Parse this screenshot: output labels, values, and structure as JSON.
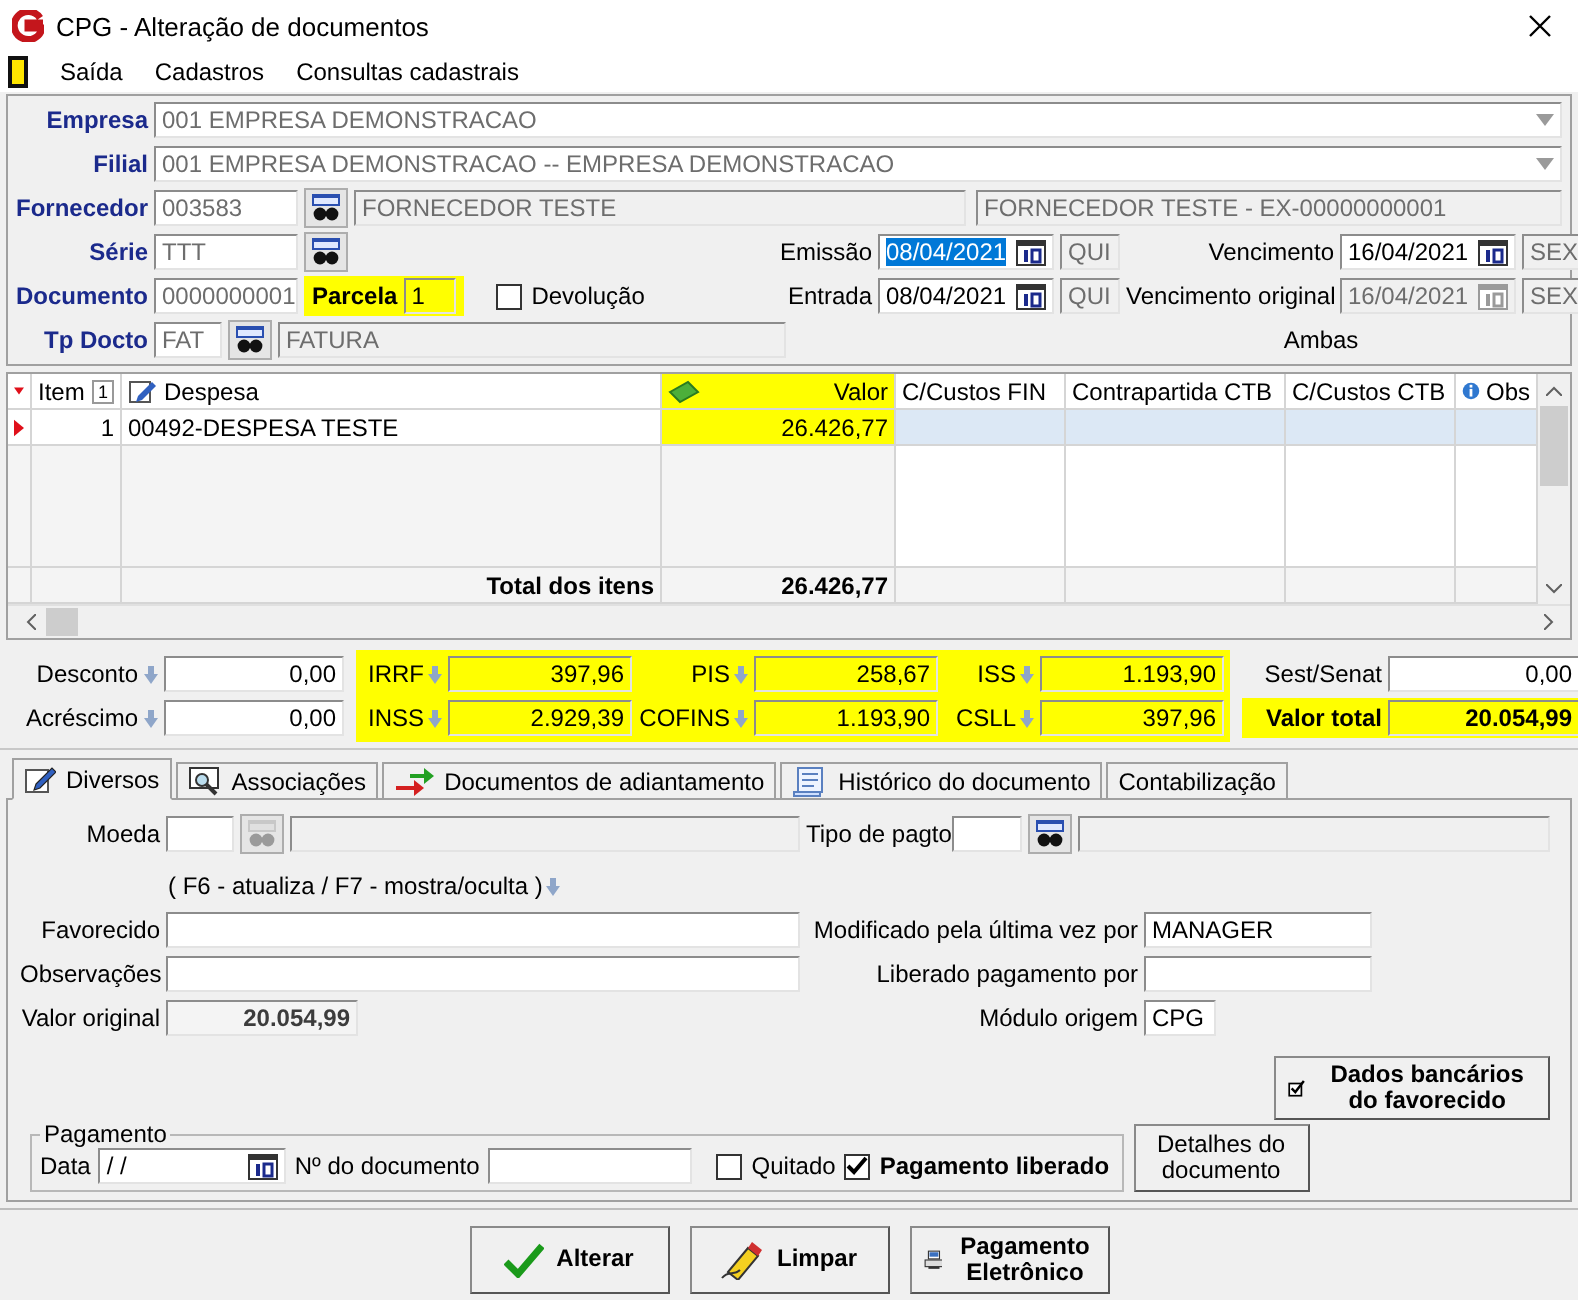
{
  "window": {
    "title": "CPG - Alteração de documentos"
  },
  "menu": [
    "Saída",
    "Cadastros",
    "Consultas cadastrais"
  ],
  "header": {
    "empresa": {
      "label": "Empresa",
      "value": "001 EMPRESA DEMONSTRACAO"
    },
    "filial": {
      "label": "Filial",
      "value": "001 EMPRESA DEMONSTRACAO -- EMPRESA DEMONSTRACAO"
    },
    "fornecedor": {
      "label": "Fornecedor",
      "code": "003583",
      "name": "FORNECEDOR TESTE",
      "description": "FORNECEDOR TESTE - EX-00000000001"
    },
    "serie": {
      "label": "Série",
      "value": "TTT"
    },
    "documento": {
      "label": "Documento",
      "value": "0000000001"
    },
    "parcela": {
      "label": "Parcela",
      "value": "1",
      "highlighted": true
    },
    "devolucao": {
      "label": "Devolução",
      "checked": false
    },
    "tp_docto": {
      "label": "Tp Docto",
      "code": "FAT",
      "name": "FATURA"
    },
    "dates": [
      {
        "label": "Emissão",
        "date": "08/04/2021",
        "weekday": "QUI",
        "selected": true,
        "disabled": false
      },
      {
        "label": "Vencimento",
        "date": "16/04/2021",
        "weekday": "SEX",
        "selected": false,
        "disabled": false
      },
      {
        "label": "Entrada",
        "date": "08/04/2021",
        "weekday": "QUI",
        "selected": false,
        "disabled": false
      },
      {
        "label": "Vencimento original",
        "date": "16/04/2021",
        "weekday": "SEX",
        "selected": false,
        "disabled": true
      }
    ],
    "ambas": "Ambas"
  },
  "grid": {
    "item_header": "Item",
    "item_sort": "1",
    "columns": [
      {
        "label": "Despesa",
        "highlighted": false
      },
      {
        "label": "Valor",
        "highlighted": true
      },
      {
        "label": "C/Custos FIN",
        "highlighted": false
      },
      {
        "label": "Contrapartida CTB",
        "highlighted": false
      },
      {
        "label": "C/Custos CTB",
        "highlighted": false
      },
      {
        "label": "Obs",
        "highlighted": false
      }
    ],
    "rows": [
      {
        "item": "1",
        "despesa": "00492-DESPESA TESTE",
        "valor": "26.426,77",
        "selected": true
      }
    ],
    "total_label": "Total dos itens",
    "total_value": "26.426,77"
  },
  "totals": {
    "adjustments": [
      {
        "label": "Desconto",
        "value": "0,00"
      },
      {
        "label": "Acréscimo",
        "value": "0,00"
      }
    ],
    "taxes_highlighted": true,
    "taxes": [
      {
        "label": "IRRF",
        "value": "397,96"
      },
      {
        "label": "PIS",
        "value": "258,67"
      },
      {
        "label": "ISS",
        "value": "1.193,90"
      },
      {
        "label": "INSS",
        "value": "2.929,39"
      },
      {
        "label": "COFINS",
        "value": "1.193,90"
      },
      {
        "label": "CSLL",
        "value": "397,96"
      }
    ],
    "sest_senat": {
      "label": "Sest/Senat",
      "value": "0,00"
    },
    "valor_total": {
      "label": "Valor total",
      "value": "20.054,99",
      "highlighted": true
    }
  },
  "tabs": [
    {
      "label": "Diversos",
      "selected": true
    },
    {
      "label": "Associações",
      "selected": false
    },
    {
      "label": "Documentos de adiantamento",
      "selected": false
    },
    {
      "label": "Histórico do documento",
      "selected": false
    },
    {
      "label": "Contabilização",
      "selected": false
    }
  ],
  "panel": {
    "moeda": {
      "label": "Moeda",
      "disabled": true
    },
    "tipo_pagto": {
      "label": "Tipo de pagto",
      "disabled": false
    },
    "hint": "( F6 - atualiza / F7 - mostra/oculta )",
    "favorecido": {
      "label": "Favorecido"
    },
    "observacoes": {
      "label": "Observações"
    },
    "valor_original": {
      "label": "Valor original",
      "value": "20.054,99"
    },
    "modificado": {
      "label": "Modificado pela última vez por",
      "value": "MANAGER"
    },
    "liberado_por": {
      "label": "Liberado pagamento por"
    },
    "modulo": {
      "label": "Módulo origem",
      "value": "CPG"
    },
    "dados_bancarios": "Dados bancários do favorecido",
    "pagamento": {
      "legend": "Pagamento",
      "data_label": "Data",
      "data_value": "/ /",
      "documento_label": "Nº do documento",
      "checks": [
        {
          "label": "Quitado",
          "checked": false
        },
        {
          "label": "Pagamento liberado",
          "checked": true
        }
      ]
    },
    "detalhes": "Detalhes do documento"
  },
  "buttons": [
    {
      "label": "Alterar",
      "kind": "confirm"
    },
    {
      "label": "Limpar",
      "kind": "clear"
    },
    {
      "label": "Pagamento Eletrônico",
      "kind": "payment"
    }
  ]
}
